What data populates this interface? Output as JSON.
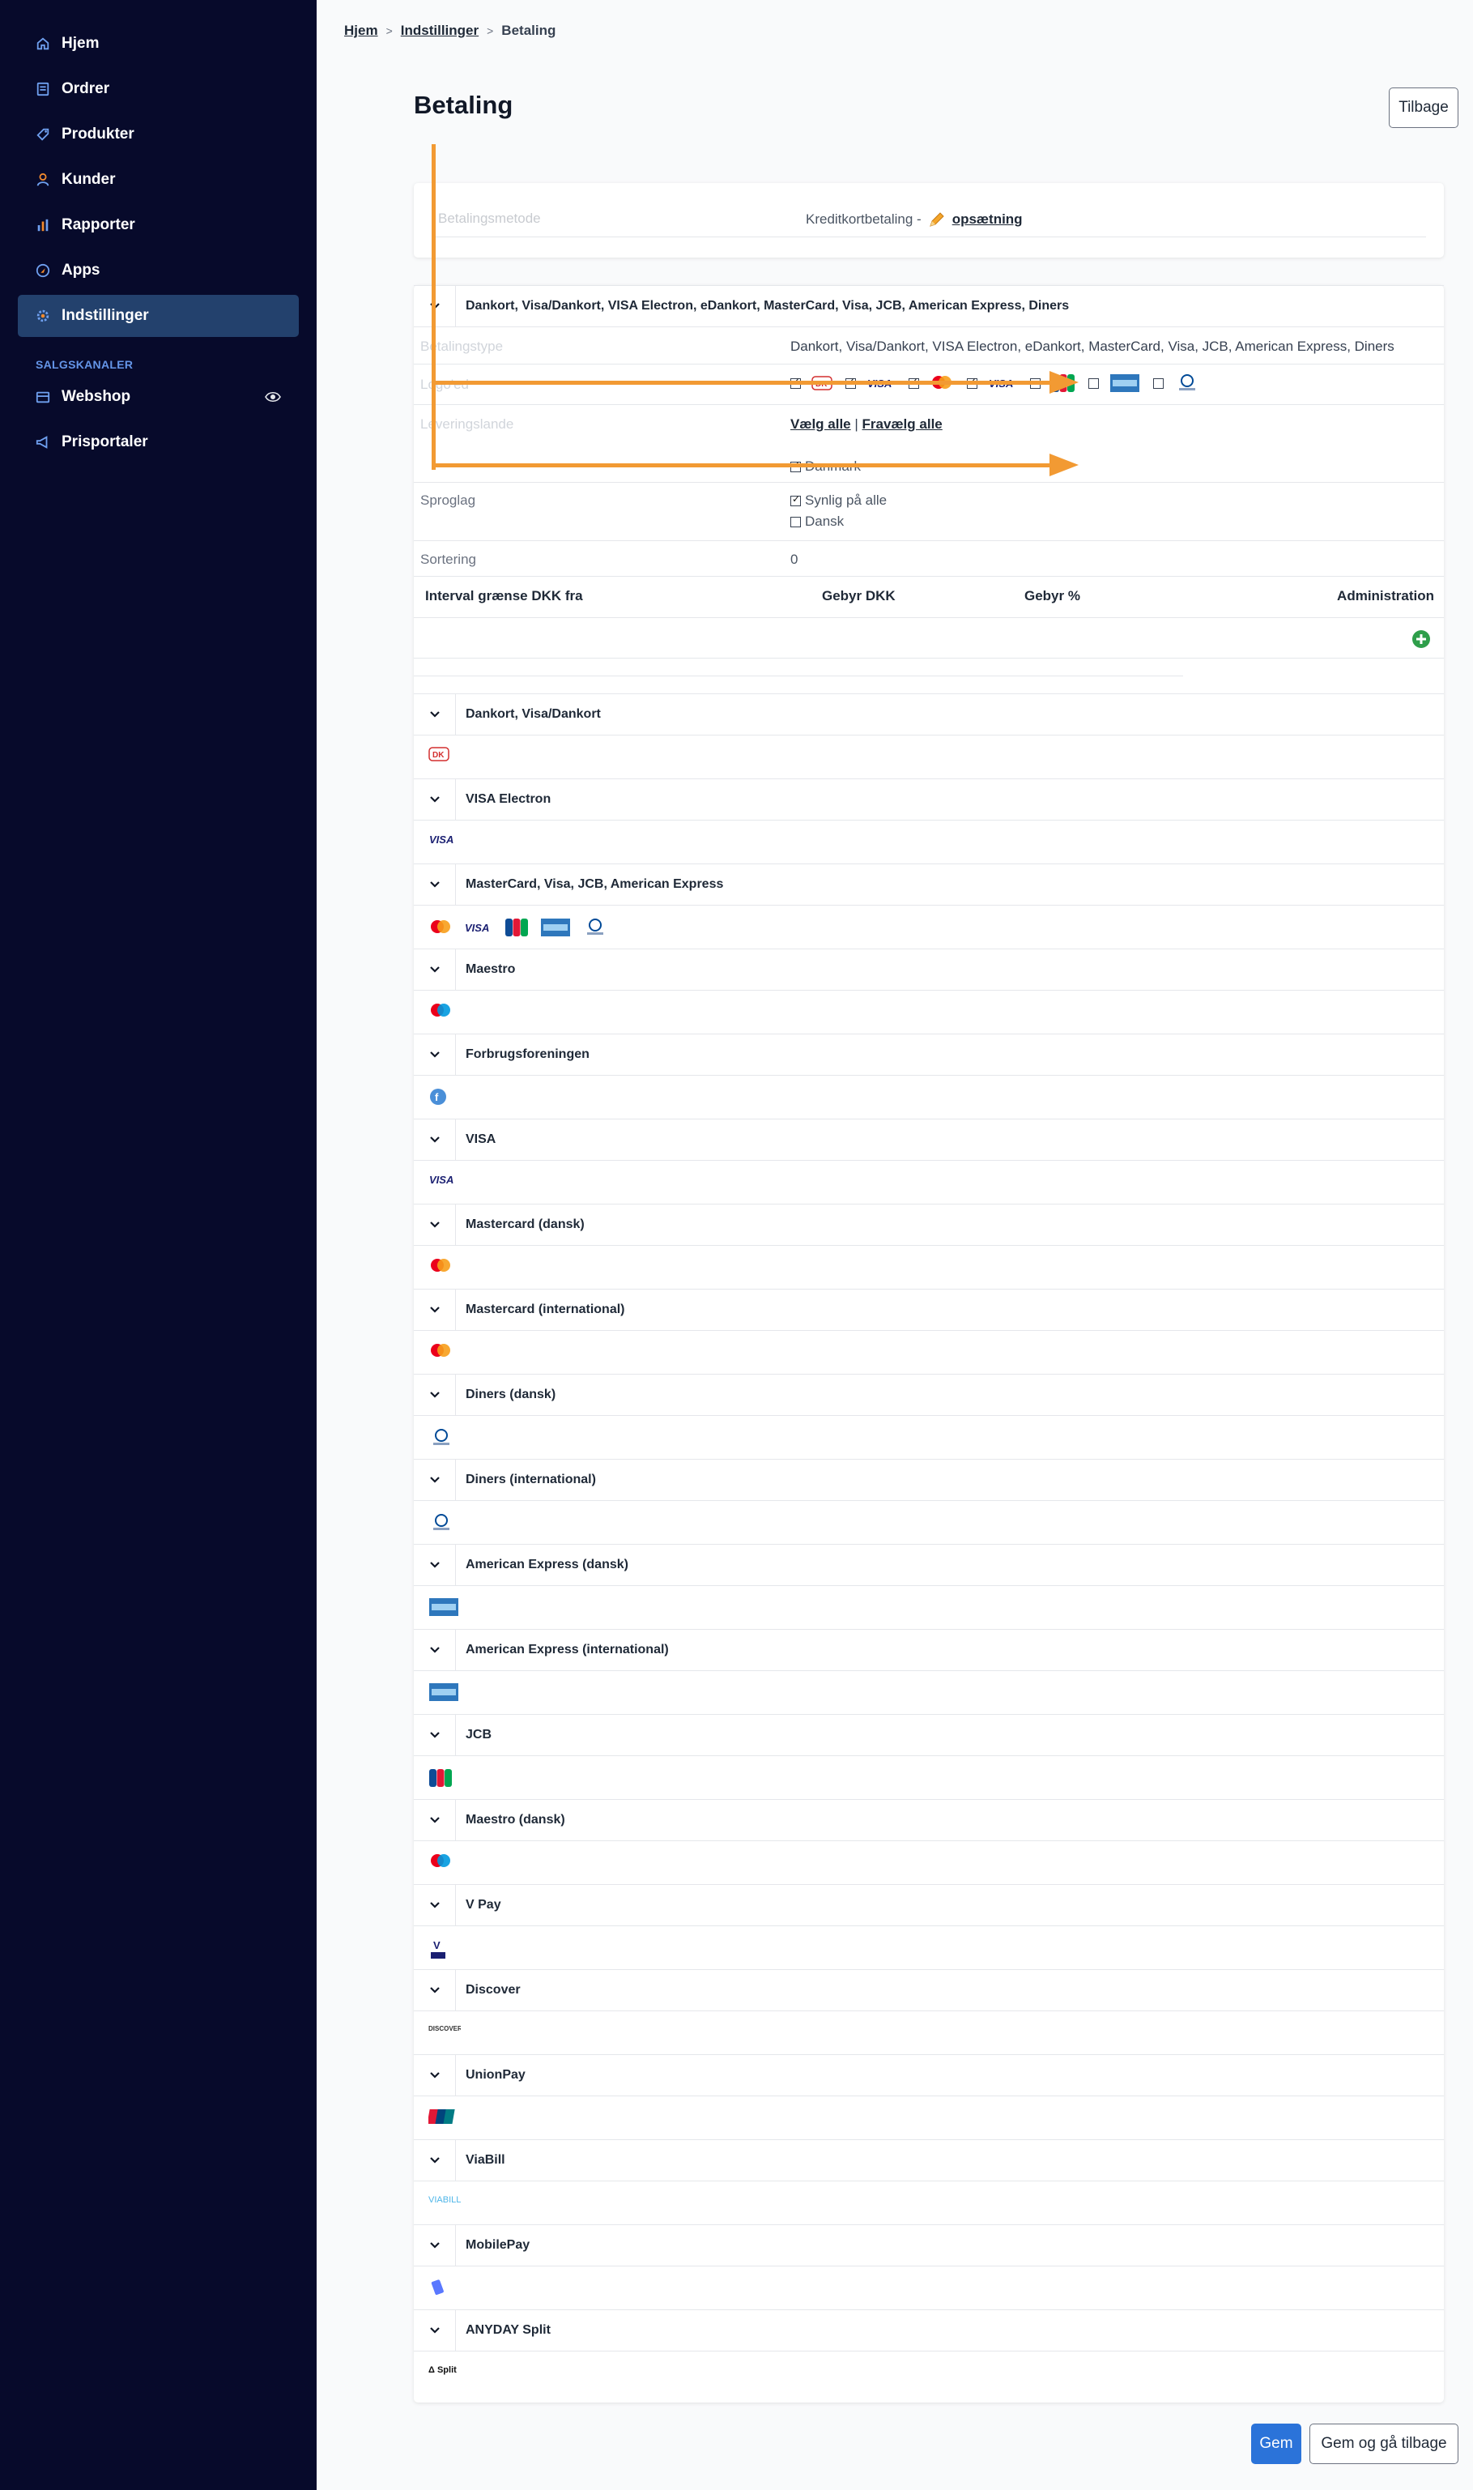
{
  "sidebar": {
    "items": [
      {
        "label": "Hjem",
        "icon": "home-icon"
      },
      {
        "label": "Ordrer",
        "icon": "orders-icon"
      },
      {
        "label": "Produkter",
        "icon": "tag-icon"
      },
      {
        "label": "Kunder",
        "icon": "user-icon"
      },
      {
        "label": "Rapporter",
        "icon": "chart-icon"
      },
      {
        "label": "Apps",
        "icon": "rocket-icon"
      },
      {
        "label": "Indstillinger",
        "icon": "gear-icon",
        "active": true
      }
    ],
    "section_label": "SALGSKANALER",
    "channels": [
      {
        "label": "Webshop",
        "icon": "shop-icon",
        "extra_icon": "eye-icon"
      },
      {
        "label": "Prisportaler",
        "icon": "megaphone-icon"
      }
    ]
  },
  "breadcrumb": {
    "home": "Hjem",
    "settings": "Indstillinger",
    "current": "Betaling"
  },
  "page": {
    "title": "Betaling",
    "back_label": "Tilbage"
  },
  "method": {
    "label": "Betalingsmetode",
    "value": "Kreditkortbetaling -",
    "link": "opsætning"
  },
  "main_group": {
    "title": "Dankort, Visa/Dankort, VISA Electron, eDankort, MasterCard, Visa, JCB, American Express, Diners"
  },
  "fields": {
    "type_label": "Betalingstype",
    "type_value": "Dankort, Visa/Dankort, VISA Electron, eDankort, MasterCard, Visa, JCB, American Express, Diners",
    "logos_label": "Logo'ed",
    "countries_label": "Leveringslande",
    "select_all": "Vælg alle",
    "separator": "|",
    "deselect_all": "Fravælg alle",
    "country": "Danmark",
    "language_label": "Sproglag",
    "lang_all": "Synlig på alle",
    "lang_dansk": "Dansk",
    "sort_label": "Sortering",
    "sort_value": "0"
  },
  "table": {
    "headers": [
      "Interval grænse DKK fra",
      "Gebyr DKK",
      "Gebyr %",
      "Administration"
    ]
  },
  "groups": [
    {
      "title": "Dankort, Visa/Dankort",
      "icons": [
        "dankort-icon"
      ]
    },
    {
      "title": "VISA Electron",
      "icons": [
        "visa-icon"
      ]
    },
    {
      "title": "MasterCard, Visa, JCB, American Express",
      "icons": [
        "mastercard-icon",
        "visa-icon",
        "jcb-icon",
        "amex-icon",
        "diners-icon"
      ]
    },
    {
      "title": "Maestro",
      "icons": [
        "maestro-icon"
      ]
    },
    {
      "title": "Forbrugsforeningen",
      "icons": [
        "forbrugsforeningen-icon"
      ]
    },
    {
      "title": "VISA",
      "icons": [
        "visa-icon"
      ]
    },
    {
      "title": "Mastercard (dansk)",
      "icons": [
        "mastercard-icon"
      ]
    },
    {
      "title": "Mastercard (international)",
      "icons": [
        "mastercard-icon"
      ]
    },
    {
      "title": "Diners (dansk)",
      "icons": [
        "diners-icon"
      ]
    },
    {
      "title": "Diners (international)",
      "icons": [
        "diners-icon"
      ]
    },
    {
      "title": "American Express (dansk)",
      "icons": [
        "amex-icon"
      ]
    },
    {
      "title": "American Express (international)",
      "icons": [
        "amex-icon"
      ]
    },
    {
      "title": "JCB",
      "icons": [
        "jcb-icon"
      ]
    },
    {
      "title": "Maestro (dansk)",
      "icons": [
        "maestro-icon"
      ]
    },
    {
      "title": "V Pay",
      "icons": [
        "vpay-icon"
      ]
    },
    {
      "title": "Discover",
      "icons": [
        "discover-icon"
      ]
    },
    {
      "title": "UnionPay",
      "icons": [
        "unionpay-icon"
      ]
    },
    {
      "title": "ViaBill",
      "icons": [
        "viabill-icon"
      ]
    },
    {
      "title": "MobilePay",
      "icons": [
        "mobilepay-icon"
      ]
    },
    {
      "title": "ANYDAY Split",
      "icons": [
        "anyday-icon"
      ]
    }
  ],
  "footer": {
    "save": "Gem",
    "save_back": "Gem og gå tilbage"
  },
  "colors": {
    "sidebar_bg": "#070a2b",
    "active_bg": "#23416d",
    "accent": "#2b73d9",
    "annotation_arrow": "#f29a33",
    "add_green": "#2e9e4a"
  }
}
